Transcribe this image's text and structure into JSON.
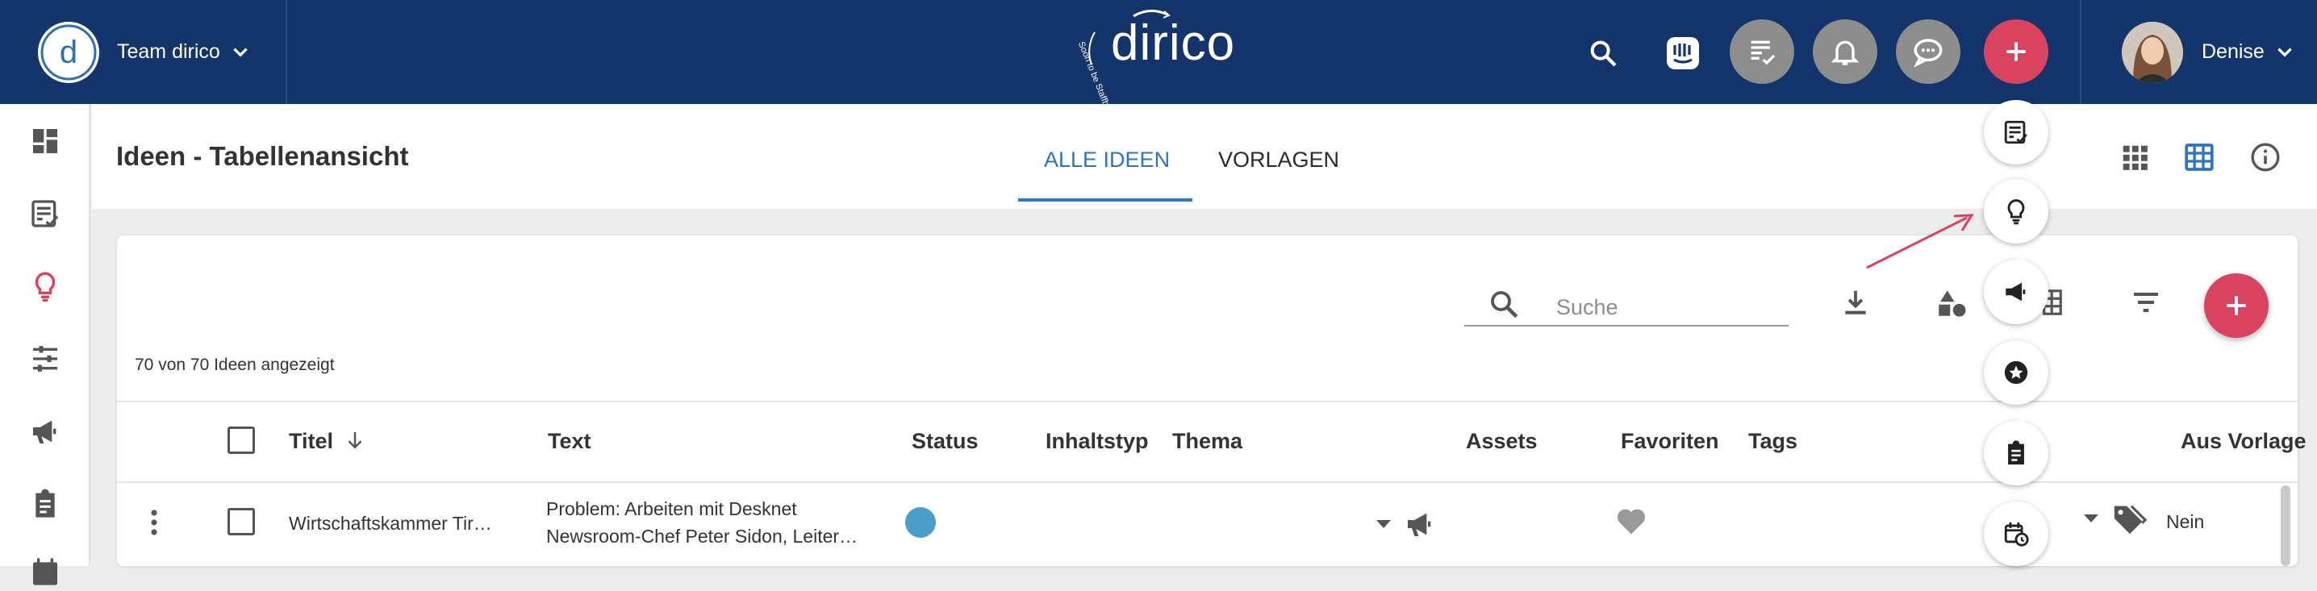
{
  "topbar": {
    "team_name": "Team dirico",
    "brand_name": "dirico",
    "brand_tagline": "Soon to be Staffbase",
    "user_name": "Denise",
    "icons": [
      "search-icon",
      "intercom-icon",
      "tasks-icon",
      "bell-icon",
      "chat-icon",
      "plus-icon"
    ]
  },
  "sidebar": {
    "items": [
      "dashboard-icon",
      "tasks-icon",
      "lightbulb-icon",
      "tune-icon",
      "megaphone-icon",
      "clipboard-icon",
      "calendar-icon"
    ],
    "active_item": "lightbulb-icon"
  },
  "header": {
    "title": "Ideen - Tabellenansicht",
    "tabs": [
      {
        "label": "ALLE IDEEN",
        "active": true
      },
      {
        "label": "VORLAGEN",
        "active": false
      }
    ],
    "view_icons": [
      "grid-view-icon",
      "table-view-icon",
      "info-icon"
    ]
  },
  "toolbar": {
    "search_placeholder": "Suche",
    "count_text": "70 von 70 Ideen angezeigt"
  },
  "table": {
    "columns": [
      "Titel",
      "Text",
      "Status",
      "Inhaltstyp",
      "Thema",
      "Assets",
      "Favoriten",
      "Tags",
      "Aus Vorlage"
    ],
    "rows": [
      {
        "title": "Wirtschaftskammer Tir…",
        "text_line1": "Problem: Arbeiten mit Desknet",
        "text_line2": "Newsroom-Chef Peter Sidon, Leiter…",
        "aus_vorlage": "Nein"
      }
    ]
  },
  "speed_dial": {
    "items": [
      "tasks-icon",
      "lightbulb-icon",
      "megaphone-icon",
      "star-icon",
      "clipboard-icon",
      "calendar-clock-icon"
    ]
  },
  "colors": {
    "topbar": "#13356b",
    "accent": "#d9435f",
    "tab_active": "#2e74c0",
    "status": "#4a9ec9"
  }
}
